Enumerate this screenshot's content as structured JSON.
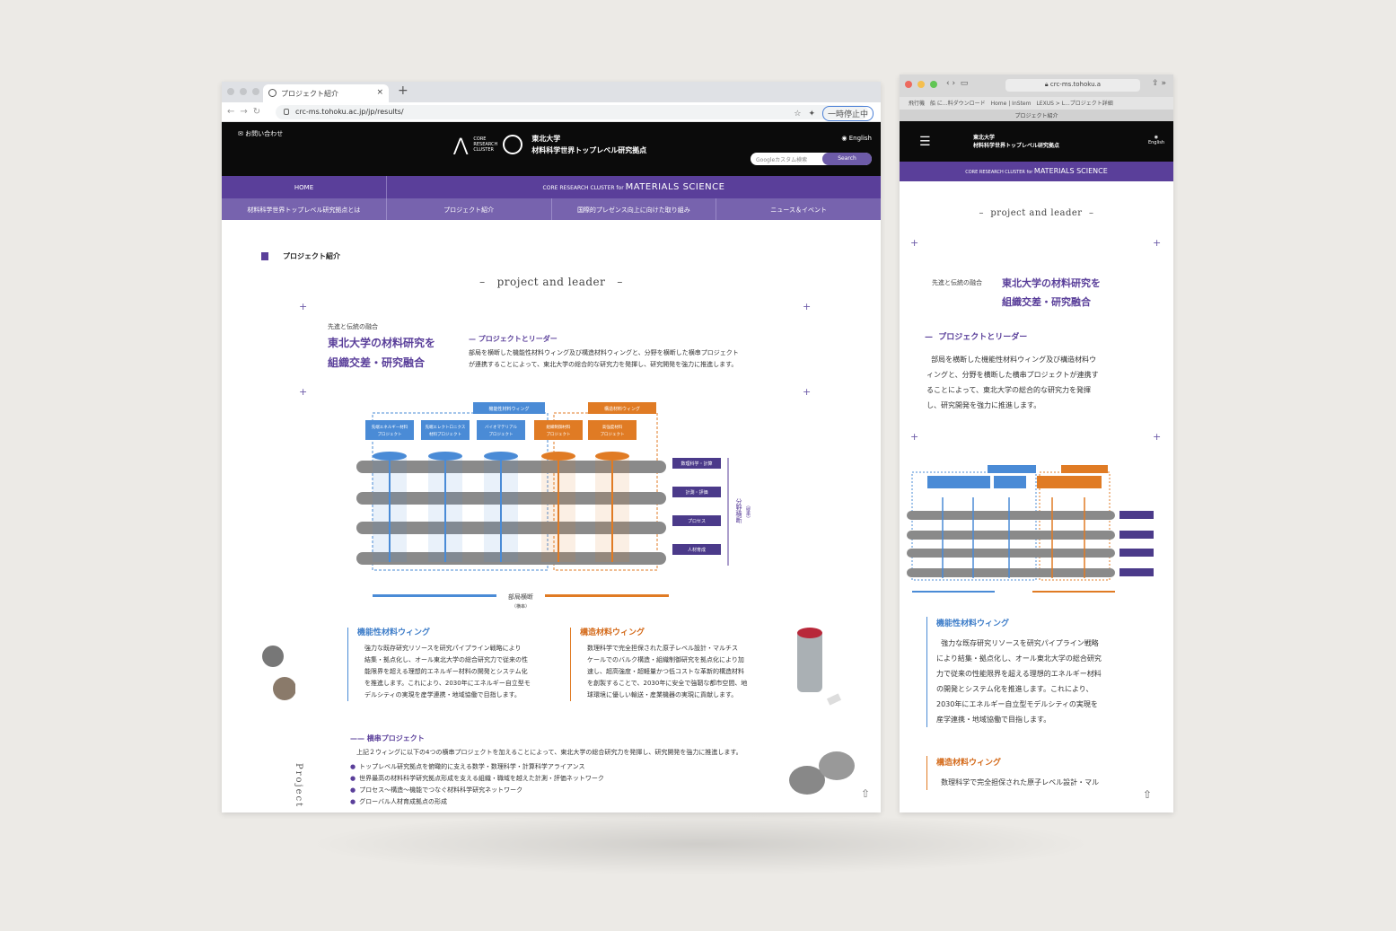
{
  "browser": {
    "tab_title": "プロジェクト紹介",
    "url": "crc-ms.tohoku.ac.jp/jp/results/",
    "pause_label": "一時停止中"
  },
  "site": {
    "contact": "お問い合わせ",
    "university": "東北大学",
    "center": "材料科学世界トップレベル研究拠点",
    "cluster_lines": [
      "CORE",
      "RESEARCH",
      "CLUSTER"
    ],
    "tohoku": "TOHOKU",
    "english": "English",
    "search_placeholder": "Googleカスタム検索",
    "search_button": "Search",
    "band_small": "CORE RESEARCH CLUSTER for",
    "band_large": "MATERIALS SCIENCE"
  },
  "nav": {
    "home": "HOME",
    "items": [
      "材料科学世界トップレベル研究拠点とは",
      "プロジェクト紹介",
      "国際的プレゼンス向上に向けた取り組み",
      "ニュース＆イベント"
    ]
  },
  "page": {
    "breadcrumb": "プロジェクト紹介",
    "section_label": "project and leader",
    "kicker": "先進と伝統の融合",
    "headline": [
      "東北大学の材料研究を",
      "組織交差・研究融合"
    ],
    "subhead": "プロジェクトとリーダー",
    "intro": [
      "部局を横断した機能性材料ウィング及び構造材料ウィングと、分野を横断した横串プロジェクト",
      "が連携することによって、東北大学の総合的な研究力を発揮し、研究開発を強力に推進します。"
    ],
    "diagram": {
      "functional_wing": "機能性材料ウィング",
      "structural_wing": "構造材料ウィング",
      "projects": [
        [
          "先端エネルギー材料",
          "プロジェクト"
        ],
        [
          "先端エレクトロニクス",
          "材料プロジェクト"
        ],
        [
          "バイオマテリアル",
          "プロジェクト"
        ],
        [
          "組織制御材料",
          "プロジェクト"
        ],
        [
          "高強度材料",
          "プロジェクト"
        ]
      ],
      "fields": [
        "数理科学・計算",
        "計測・評価",
        "プロセス",
        "人材育成"
      ],
      "vertical_label": "分野横断",
      "vertical_sub": "（縦串）",
      "bottom_label": "部局横断",
      "bottom_sub": "（横串）"
    },
    "wing_functional": {
      "title": "機能性材料ウィング",
      "lines": [
        "強力な既存研究リソースを研究パイプライン戦略により",
        "結集・拠点化し、オール東北大学の総合研究力で従来の性",
        "能限界を超える理想的エネルギー材料の開発とシステム化",
        "を推進します。これにより、2030年にエネルギー自立型モ",
        "デルシティの実現を産学連携・地域協働で目指します。"
      ]
    },
    "wing_structural": {
      "title": "構造材料ウィング",
      "lines": [
        "数理科学で完全担保された原子レベル設計・マルチス",
        "ケールでのバルク構造・組織制御研究を拠点化により加",
        "速し、超高強度・超軽量かつ低コストな革新的構造材料",
        "を創製することで、2030年に安全で強靭な都市空間、地",
        "球環境に優しい輸送・産業機器の実現に貢献します。"
      ]
    },
    "cross_title": "横串プロジェクト",
    "cross_intro": "上記２ウィングに以下の4つの横串プロジェクトを加えることによって、東北大学の総合研究力を発揮し、研究開発を強力に推進します。",
    "cross_items": [
      "トップレベル研究拠点を俯瞰的に支える数学・数理科学・計算科学アライアンス",
      "世界最高の材料科学研究拠点形成を支える組織・職域を越えた計測・評価ネットワーク",
      "プロセス～構造～機能でつなぐ材料科学研究ネットワーク",
      "グローバル人材育成拠点の形成"
    ],
    "vertical_word": "Project"
  },
  "mobile": {
    "url": "crc-ms.tohoku.a",
    "bookmarks": "飛行機　船 に...料ダウンロード　Home | InStem　LEXUS > L...プロジェクト詳細",
    "tab": "プロジェクト紹介",
    "intro": [
      "部局を横断した機能性材料ウィング及び構造材料ウ",
      "ィングと、分野を横断した横串プロジェクトが連携す",
      "ることによって、東北大学の総合的な研究力を発揮",
      "し、研究開発を強力に推進します。"
    ],
    "wing_lines": [
      "強力な既存研究リソースを研究パイプライン戦略",
      "により結集・拠点化し、オール東北大学の総合研究",
      "力で従来の性能限界を超える理想的エネルギー材料",
      "の開発とシステム化を推進します。これにより、",
      "2030年にエネルギー自立型モデルシティの実現を",
      "産学連携・地域協働で目指します。"
    ],
    "structural_line": "数理科学で完全担保された原子レベル設計・マル"
  },
  "colors": {
    "purple": "#5a3f9a",
    "blue": "#3f7ec9",
    "orange": "#d46a1a"
  }
}
